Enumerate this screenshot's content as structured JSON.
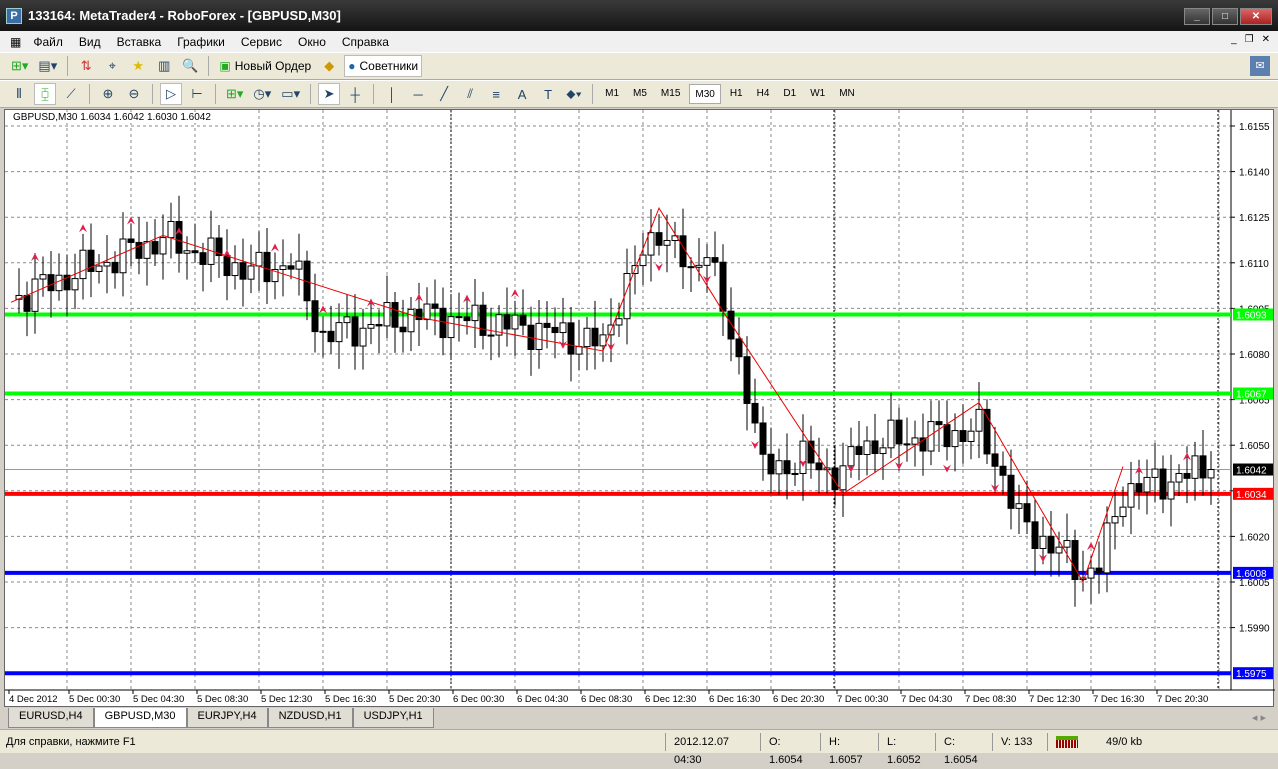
{
  "title": "133164: MetaTrader4 - RoboForex - [GBPUSD,M30]",
  "menu": [
    "Файл",
    "Вид",
    "Вставка",
    "Графики",
    "Сервис",
    "Окно",
    "Справка"
  ],
  "toolbar1": {
    "new_order": "Новый Ордер",
    "experts": "Советники"
  },
  "timeframes": [
    "M1",
    "M5",
    "M15",
    "M30",
    "H1",
    "H4",
    "D1",
    "W1",
    "MN"
  ],
  "active_timeframe": "M30",
  "chart_header": "GBPUSD,M30  1.6034 1.6042 1.6030 1.6042",
  "chart_data": {
    "type": "candlestick",
    "symbol": "GBPUSD",
    "timeframe": "M30",
    "ylim": [
      1.5965,
      1.6162
    ],
    "y_ticks": [
      "1.6155",
      "1.6140",
      "1.6125",
      "1.6110",
      "1.6095",
      "1.6080",
      "1.6065",
      "1.6050",
      "1.6035",
      "1.6020",
      "1.6005",
      "1.5990"
    ],
    "x_ticks": [
      "4 Dec 2012",
      "5 Dec 00:30",
      "5 Dec 04:30",
      "5 Dec 08:30",
      "5 Dec 12:30",
      "5 Dec 16:30",
      "5 Dec 20:30",
      "6 Dec 00:30",
      "6 Dec 04:30",
      "6 Dec 08:30",
      "6 Dec 12:30",
      "6 Dec 16:30",
      "6 Dec 20:30",
      "7 Dec 00:30",
      "7 Dec 04:30",
      "7 Dec 08:30",
      "7 Dec 12:30",
      "7 Dec 16:30",
      "7 Dec 20:30"
    ],
    "close_waypoints": [
      [
        0,
        1.6098
      ],
      [
        19,
        1.6118
      ],
      [
        30,
        1.6107
      ],
      [
        35,
        1.611
      ],
      [
        39,
        1.6086
      ],
      [
        51,
        1.6093
      ],
      [
        66,
        1.6088
      ],
      [
        74,
        1.6083
      ],
      [
        76,
        1.6098
      ],
      [
        81,
        1.6122
      ],
      [
        85,
        1.6106
      ],
      [
        87,
        1.6117
      ],
      [
        89,
        1.6093
      ],
      [
        92,
        1.607
      ],
      [
        94,
        1.6042
      ],
      [
        99,
        1.6045
      ],
      [
        104,
        1.604
      ],
      [
        106,
        1.605
      ],
      [
        121,
        1.6055
      ],
      [
        124,
        1.604
      ],
      [
        126,
        1.6025
      ],
      [
        131,
        1.6015
      ],
      [
        134,
        1.6008
      ],
      [
        136,
        1.601
      ],
      [
        139,
        1.6035
      ],
      [
        150,
        1.6042
      ]
    ],
    "zigzag": [
      [
        0,
        1.6097
      ],
      [
        19,
        1.6119
      ],
      [
        51,
        1.6092
      ],
      [
        74,
        1.6081
      ],
      [
        81,
        1.6128
      ],
      [
        89,
        1.6094
      ],
      [
        104,
        1.6034
      ],
      [
        121,
        1.6064
      ],
      [
        134,
        1.6005
      ],
      [
        139,
        1.6043
      ]
    ],
    "levels": [
      {
        "label": "1.6093",
        "value": 1.6093,
        "color": "#00ff00"
      },
      {
        "label": "1.6067",
        "value": 1.6067,
        "color": "#00ff00"
      },
      {
        "label": "1.6034",
        "value": 1.6034,
        "color": "#ff0000"
      },
      {
        "label": "1.6008",
        "value": 1.6008,
        "color": "#0000ff"
      },
      {
        "label": "1.5975",
        "value": 1.5975,
        "color": "#0000ff"
      }
    ],
    "current_price": {
      "label": "1.6042",
      "value": 1.6042
    }
  },
  "tabs": [
    "EURUSD,H4",
    "GBPUSD,M30",
    "EURJPY,H4",
    "NZDUSD,H1",
    "USDJPY,H1"
  ],
  "status": {
    "help": "Для справки, нажмите F1",
    "datetime": "2012.12.07 04:30",
    "open": "O: 1.6054",
    "high": "H: 1.6057",
    "low": "L: 1.6052",
    "close": "C: 1.6054",
    "volume": "V: 133",
    "traffic": "49/0 kb"
  }
}
